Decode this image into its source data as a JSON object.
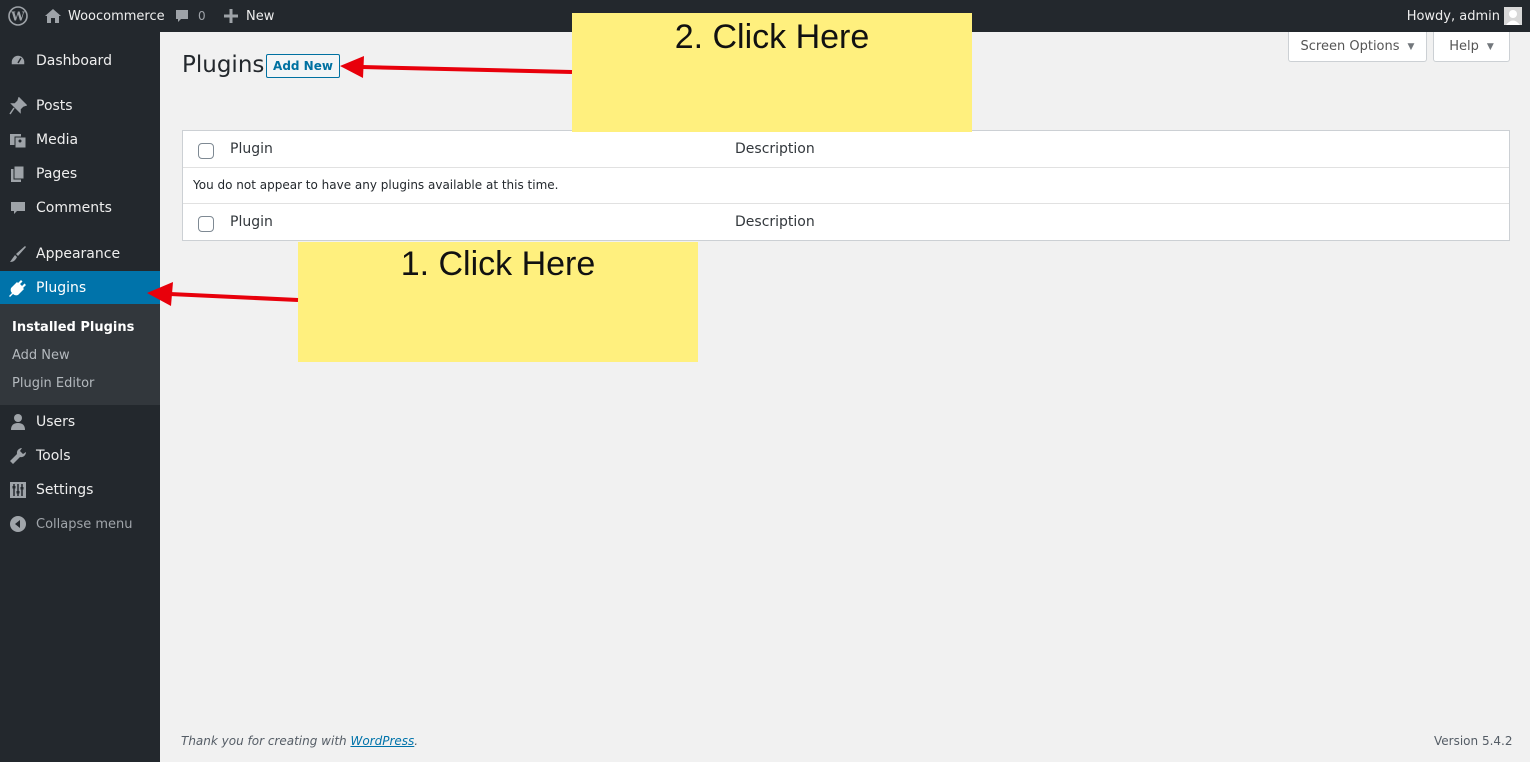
{
  "adminbar": {
    "site_name": "Woocommerce",
    "comment_count": "0",
    "new_label": "New",
    "howdy": "Howdy, admin"
  },
  "sidebar": {
    "items": [
      {
        "label": "Dashboard",
        "icon": "dashboard-icon"
      },
      {
        "label": "Posts",
        "icon": "pin-icon"
      },
      {
        "label": "Media",
        "icon": "media-icon"
      },
      {
        "label": "Pages",
        "icon": "pages-icon"
      },
      {
        "label": "Comments",
        "icon": "comment-icon"
      },
      {
        "label": "Appearance",
        "icon": "brush-icon"
      },
      {
        "label": "Plugins",
        "icon": "plugin-icon",
        "active": true
      },
      {
        "label": "Users",
        "icon": "user-icon"
      },
      {
        "label": "Tools",
        "icon": "wrench-icon"
      },
      {
        "label": "Settings",
        "icon": "settings-icon"
      }
    ],
    "submenu": [
      "Installed Plugins",
      "Add New",
      "Plugin Editor"
    ],
    "collapse_label": "Collapse menu"
  },
  "main": {
    "title": "Plugins",
    "add_new_label": "Add New",
    "screen_options_label": "Screen Options",
    "help_label": "Help",
    "table": {
      "col_plugin": "Plugin",
      "col_description": "Description",
      "empty_message": "You do not appear to have any plugins available at this time."
    }
  },
  "footer": {
    "thanks_text": "Thank you for creating with",
    "wordpress_link": "WordPress",
    "period": ".",
    "version": "Version 5.4.2"
  },
  "annotations": {
    "note1": "1. Click Here",
    "note2": "2. Click Here"
  },
  "colors": {
    "admin_bar": "#23282d",
    "active_menu": "#0073aa",
    "note": "#fff07e",
    "arrow": "#e8000b"
  }
}
